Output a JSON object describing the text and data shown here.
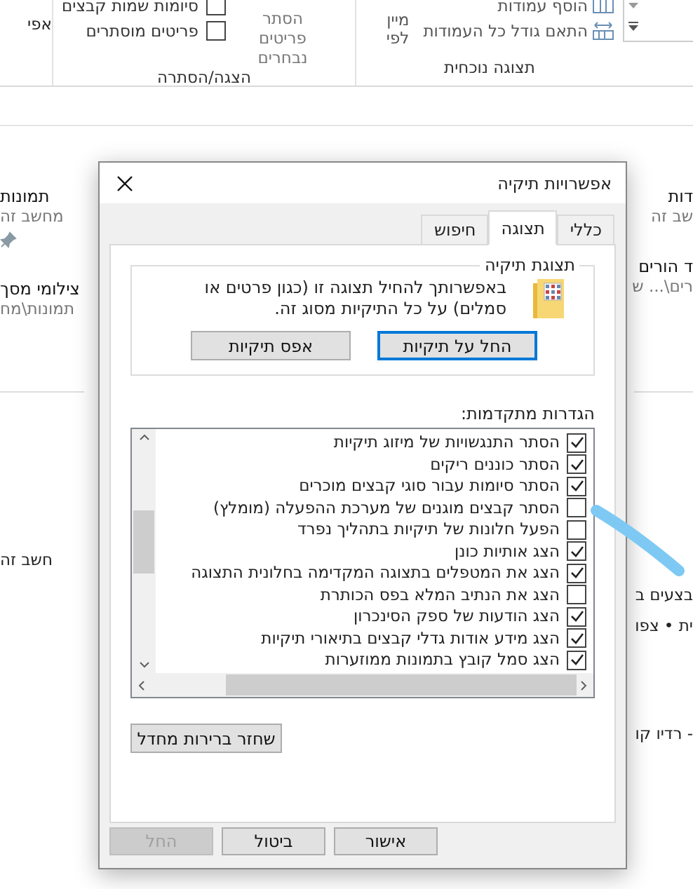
{
  "ribbon": {
    "current_view": {
      "title": "תצוגה נוכחית",
      "sort_button": "מיין לפי",
      "add_columns": "הוסף עמודות",
      "fit_columns": "התאם גודל כל העמודות"
    },
    "show_hide": {
      "title": "הצגה/הסתרה",
      "checkboxes": [
        {
          "label": "סיומות שמות קבצים",
          "checked": false
        },
        {
          "label": "פריטים מוסתרים",
          "checked": false
        }
      ],
      "hide_selected_button": "הסתר פריטים נבחרים"
    },
    "cut_label": "אפי"
  },
  "quick_access": {
    "left_items": [
      {
        "name": "תמונות",
        "location": "מחשב זה",
        "pinned": true
      },
      {
        "name": "צילומי מסך",
        "location": "תמונות\\מח"
      }
    ],
    "right_items": [
      {
        "name": "דות",
        "location": "שב זה"
      },
      {
        "name": "ד הורים",
        "location": "רים\\... ש"
      }
    ]
  },
  "recent": {
    "left": [
      "חשב זה"
    ],
    "right": [
      "בצעים ב",
      "ית • צפו",
      "- רדיו קו"
    ]
  },
  "dialog": {
    "title": "אפשרויות תיקיה",
    "tabs": [
      {
        "label": "כללי",
        "selected": false
      },
      {
        "label": "תצוגה",
        "selected": true
      },
      {
        "label": "חיפוש",
        "selected": false
      }
    ],
    "folder_views": {
      "title": "תצוגת תיקיה",
      "description": "באפשרותך להחיל תצוגה זו (כגון פרטים או סמלים) על כל התיקיות מסוג זה.",
      "apply_button": {
        "label": "החל על תיקיות",
        "focused": true
      },
      "reset_button": {
        "label": "אפס תיקיות",
        "focused": false
      }
    },
    "advanced": {
      "label": "הגדרות מתקדמות:",
      "items": [
        {
          "label": "הסתר התנגשויות של מיזוג תיקיות",
          "checked": true
        },
        {
          "label": "הסתר כוננים ריקים",
          "checked": true
        },
        {
          "label": "הסתר סיומות עבור סוגי קבצים מוכרים",
          "checked": true
        },
        {
          "label": "הסתר קבצים מוגנים של מערכת ההפעלה (מומלץ)",
          "checked": false
        },
        {
          "label": "הפעל חלונות של תיקיות בתהליך נפרד",
          "checked": false
        },
        {
          "label": "הצג אותיות כונן",
          "checked": true
        },
        {
          "label": "הצג את המטפלים בתצוגה המקדימה בחלונית התצוגה",
          "checked": true
        },
        {
          "label": "הצג את הנתיב המלא בפס הכותרת",
          "checked": false
        },
        {
          "label": "הצג הודעות של ספק הסינכרון",
          "checked": true
        },
        {
          "label": "הצג מידע אודות גדלי קבצים בתיאורי תיקיות",
          "checked": true
        },
        {
          "label": "הצג סמל קובץ בתמונות ממוזערות",
          "checked": true
        }
      ]
    },
    "restore_button": "שחזר ברירות מחדל",
    "buttons": [
      {
        "label": "אישור",
        "disabled": false
      },
      {
        "label": "ביטול",
        "disabled": false
      },
      {
        "label": "החל",
        "disabled": true
      }
    ]
  }
}
